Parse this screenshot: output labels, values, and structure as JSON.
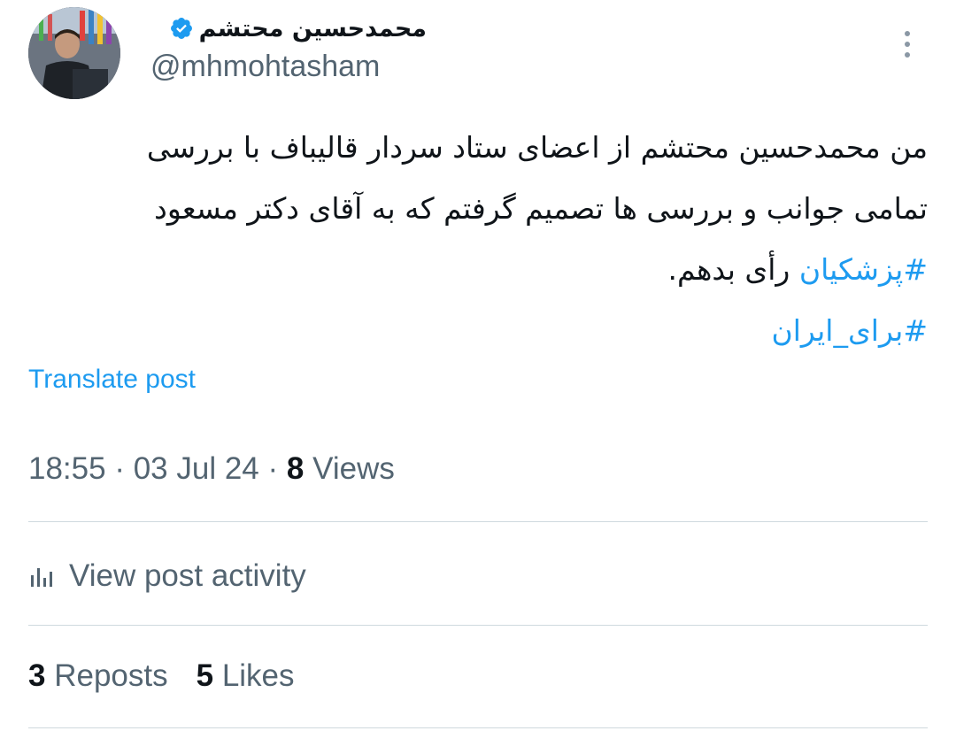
{
  "author": {
    "display_name": "محمدحسین محتشم",
    "handle": "@mhmohtasham",
    "verified": true
  },
  "post": {
    "text_line_1": "من محمدحسین محتشم از اعضای ستاد سردار قالیباف با بررسی",
    "text_line_2": "تمامی جوانب و بررسی ها تصمیم گرفتم که به آقای دکتر مسعود",
    "hashtag_1": "#پزشکیان",
    "text_line_3_suffix": "رأی بدهم.",
    "hashtag_2": "#برای_ایران"
  },
  "translate_label": "Translate post",
  "meta": {
    "time": "18:55",
    "date": "03 Jul 24",
    "views_count": "8",
    "views_label": "Views"
  },
  "activity_label": "View post activity",
  "stats": {
    "reposts_count": "3",
    "reposts_label": "Reposts",
    "likes_count": "5",
    "likes_label": "Likes"
  },
  "icons": {
    "verified": "verified-badge-icon",
    "more": "more-options-icon",
    "activity": "bar-chart-icon"
  },
  "colors": {
    "accent": "#1d9bf0",
    "text": "#0f1419",
    "secondary": "#536471",
    "divider": "#cfd9de"
  }
}
